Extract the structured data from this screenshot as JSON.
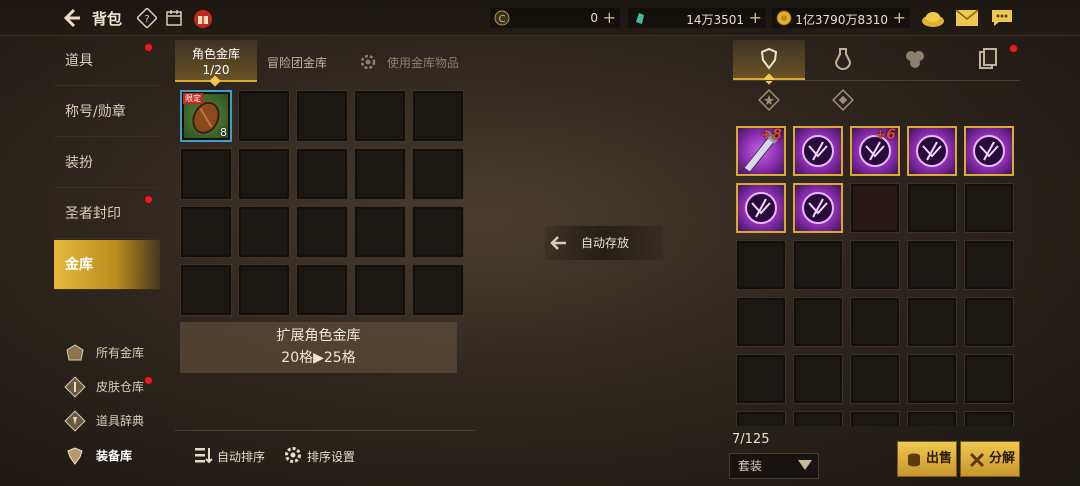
{
  "header": {
    "title": "背包",
    "icons": [
      "back-arrow-icon",
      "help-icon",
      "calendar-icon",
      "gift-icon"
    ],
    "currencies": [
      {
        "name": "coin",
        "value": "0",
        "icon": "c-coin-icon"
      },
      {
        "name": "gem",
        "value": "14万3501",
        "icon": "green-gem-icon"
      },
      {
        "name": "gold",
        "value": "1亿3790万8310",
        "icon": "gold-coin-icon"
      }
    ],
    "right_icons": [
      "treasure-icon",
      "mail-icon",
      "chat-icon"
    ]
  },
  "sidebar": {
    "items": [
      {
        "label": "道具",
        "badge": true
      },
      {
        "label": "称号/勋章",
        "badge": false
      },
      {
        "label": "装扮",
        "badge": false
      },
      {
        "label": "圣者封印",
        "badge": true
      },
      {
        "label": "金库",
        "badge": false,
        "active": true
      }
    ],
    "sub_items": [
      {
        "label": "所有金库",
        "icon": "vault-icon"
      },
      {
        "label": "皮肤仓库",
        "icon": "skin-icon",
        "badge": true
      },
      {
        "label": "道具辞典",
        "icon": "book-icon"
      },
      {
        "label": "装备库",
        "icon": "armor-icon",
        "active": true
      }
    ]
  },
  "storage": {
    "tabs": [
      {
        "label": "角色金库",
        "sub": "1/20",
        "active": true
      },
      {
        "label": "冒险团金库"
      },
      {
        "label": "使用金库物品"
      }
    ],
    "first_item": {
      "count": "8",
      "tag": "限定",
      "icon": "seed-item-icon"
    },
    "expand": {
      "line1": "扩展角色金库",
      "line2": "20格▶25格"
    },
    "bottom_buttons": [
      {
        "label": "自动排序",
        "icon": "sort-icon"
      },
      {
        "label": "排序设置",
        "icon": "settings-gear-icon"
      }
    ]
  },
  "auto_store": {
    "label": "自动存放",
    "icon": "arrow-left-icon"
  },
  "inventory": {
    "tabs": [
      "armor-tab-icon",
      "potion-tab-icon",
      "materials-tab-icon",
      "cards-tab-icon"
    ],
    "subtabs": [
      "star-emblem-icon",
      "diamond-emblem-icon"
    ],
    "items": [
      {
        "enhance": "+8",
        "kind": "weapon"
      },
      {
        "enhance": "",
        "kind": "orb"
      },
      {
        "enhance": "+6",
        "kind": "orb"
      },
      {
        "enhance": "",
        "kind": "orb"
      },
      {
        "enhance": "",
        "kind": "orb"
      },
      {
        "enhance": "",
        "kind": "orb"
      },
      {
        "enhance": "",
        "kind": "orb"
      }
    ],
    "count": "7/125",
    "filter": "套装",
    "sell_label": "出售",
    "dismantle_label": "分解"
  },
  "colors": {
    "accent_gold": "#d9a930",
    "badge_red": "#e02020",
    "item_purple": "#8a2db0"
  }
}
